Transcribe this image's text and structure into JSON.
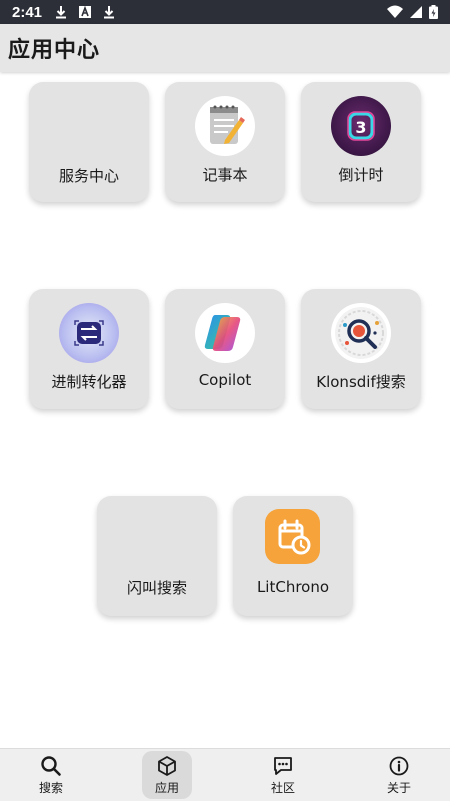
{
  "status_bar": {
    "time": "2:41",
    "left_icons": [
      "download-icon",
      "a-box-icon",
      "download-icon"
    ],
    "right_icons": [
      "wifi-icon",
      "signal-icon",
      "battery-icon"
    ]
  },
  "app_bar": {
    "title": "应用中心"
  },
  "tiles": [
    {
      "label": "服务中心",
      "icon": "none"
    },
    {
      "label": "记事本",
      "icon": "notepad-icon"
    },
    {
      "label": "倒计时",
      "icon": "countdown-icon"
    },
    {
      "label": "进制转化器",
      "icon": "converter-icon"
    },
    {
      "label": "Copilot",
      "icon": "copilot-icon"
    },
    {
      "label": "Klonsdif搜索",
      "icon": "klonsdif-search-icon"
    },
    {
      "label": "闪叫搜索",
      "icon": "none"
    },
    {
      "label": "LitChrono",
      "icon": "calendar-clock-icon"
    }
  ],
  "bottom_nav": {
    "items": [
      {
        "label": "搜索",
        "icon": "search-icon",
        "active": false
      },
      {
        "label": "应用",
        "icon": "cube-icon",
        "active": true
      },
      {
        "label": "社区",
        "icon": "chat-icon",
        "active": false
      },
      {
        "label": "关于",
        "icon": "info-icon",
        "active": false
      }
    ]
  },
  "colors": {
    "status_bar_bg": "#2d2f38",
    "app_bar_bg": "#e6e6e6",
    "tile_bg": "#e3e3e3",
    "litchrono_orange": "#f5a33a"
  }
}
